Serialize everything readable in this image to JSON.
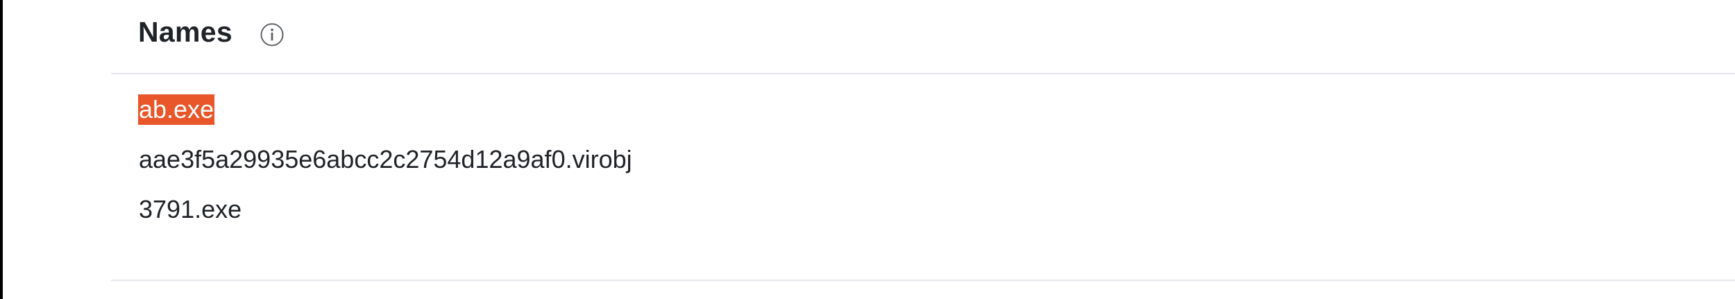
{
  "section": {
    "title": "Names",
    "info_icon": "info-circle-icon"
  },
  "names": [
    {
      "value": "ab.exe",
      "highlighted": true,
      "highlight_color": "#e8562a"
    },
    {
      "value": "aae3f5a29935e6abcc2c2754d12a9af0.virobj",
      "highlighted": false
    },
    {
      "value": "3791.exe",
      "highlighted": false
    }
  ]
}
